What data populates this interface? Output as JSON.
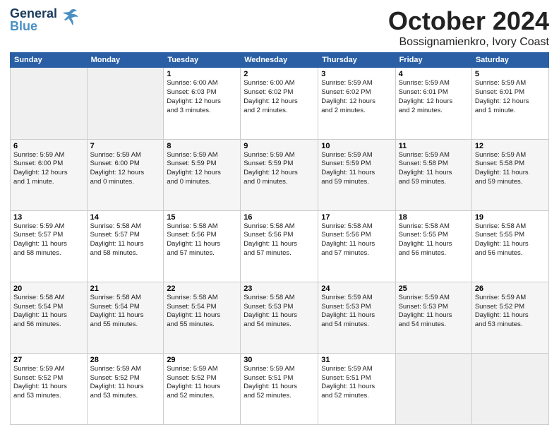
{
  "logo": {
    "line1": "General",
    "line2": "Blue"
  },
  "header": {
    "month": "October 2024",
    "location": "Bossignamienkro, Ivory Coast"
  },
  "weekdays": [
    "Sunday",
    "Monday",
    "Tuesday",
    "Wednesday",
    "Thursday",
    "Friday",
    "Saturday"
  ],
  "weeks": [
    [
      {
        "day": "",
        "info": ""
      },
      {
        "day": "",
        "info": ""
      },
      {
        "day": "1",
        "info": "Sunrise: 6:00 AM\nSunset: 6:03 PM\nDaylight: 12 hours\nand 3 minutes."
      },
      {
        "day": "2",
        "info": "Sunrise: 6:00 AM\nSunset: 6:02 PM\nDaylight: 12 hours\nand 2 minutes."
      },
      {
        "day": "3",
        "info": "Sunrise: 5:59 AM\nSunset: 6:02 PM\nDaylight: 12 hours\nand 2 minutes."
      },
      {
        "day": "4",
        "info": "Sunrise: 5:59 AM\nSunset: 6:01 PM\nDaylight: 12 hours\nand 2 minutes."
      },
      {
        "day": "5",
        "info": "Sunrise: 5:59 AM\nSunset: 6:01 PM\nDaylight: 12 hours\nand 1 minute."
      }
    ],
    [
      {
        "day": "6",
        "info": "Sunrise: 5:59 AM\nSunset: 6:00 PM\nDaylight: 12 hours\nand 1 minute."
      },
      {
        "day": "7",
        "info": "Sunrise: 5:59 AM\nSunset: 6:00 PM\nDaylight: 12 hours\nand 0 minutes."
      },
      {
        "day": "8",
        "info": "Sunrise: 5:59 AM\nSunset: 5:59 PM\nDaylight: 12 hours\nand 0 minutes."
      },
      {
        "day": "9",
        "info": "Sunrise: 5:59 AM\nSunset: 5:59 PM\nDaylight: 12 hours\nand 0 minutes."
      },
      {
        "day": "10",
        "info": "Sunrise: 5:59 AM\nSunset: 5:59 PM\nDaylight: 11 hours\nand 59 minutes."
      },
      {
        "day": "11",
        "info": "Sunrise: 5:59 AM\nSunset: 5:58 PM\nDaylight: 11 hours\nand 59 minutes."
      },
      {
        "day": "12",
        "info": "Sunrise: 5:59 AM\nSunset: 5:58 PM\nDaylight: 11 hours\nand 59 minutes."
      }
    ],
    [
      {
        "day": "13",
        "info": "Sunrise: 5:59 AM\nSunset: 5:57 PM\nDaylight: 11 hours\nand 58 minutes."
      },
      {
        "day": "14",
        "info": "Sunrise: 5:58 AM\nSunset: 5:57 PM\nDaylight: 11 hours\nand 58 minutes."
      },
      {
        "day": "15",
        "info": "Sunrise: 5:58 AM\nSunset: 5:56 PM\nDaylight: 11 hours\nand 57 minutes."
      },
      {
        "day": "16",
        "info": "Sunrise: 5:58 AM\nSunset: 5:56 PM\nDaylight: 11 hours\nand 57 minutes."
      },
      {
        "day": "17",
        "info": "Sunrise: 5:58 AM\nSunset: 5:56 PM\nDaylight: 11 hours\nand 57 minutes."
      },
      {
        "day": "18",
        "info": "Sunrise: 5:58 AM\nSunset: 5:55 PM\nDaylight: 11 hours\nand 56 minutes."
      },
      {
        "day": "19",
        "info": "Sunrise: 5:58 AM\nSunset: 5:55 PM\nDaylight: 11 hours\nand 56 minutes."
      }
    ],
    [
      {
        "day": "20",
        "info": "Sunrise: 5:58 AM\nSunset: 5:54 PM\nDaylight: 11 hours\nand 56 minutes."
      },
      {
        "day": "21",
        "info": "Sunrise: 5:58 AM\nSunset: 5:54 PM\nDaylight: 11 hours\nand 55 minutes."
      },
      {
        "day": "22",
        "info": "Sunrise: 5:58 AM\nSunset: 5:54 PM\nDaylight: 11 hours\nand 55 minutes."
      },
      {
        "day": "23",
        "info": "Sunrise: 5:58 AM\nSunset: 5:53 PM\nDaylight: 11 hours\nand 54 minutes."
      },
      {
        "day": "24",
        "info": "Sunrise: 5:59 AM\nSunset: 5:53 PM\nDaylight: 11 hours\nand 54 minutes."
      },
      {
        "day": "25",
        "info": "Sunrise: 5:59 AM\nSunset: 5:53 PM\nDaylight: 11 hours\nand 54 minutes."
      },
      {
        "day": "26",
        "info": "Sunrise: 5:59 AM\nSunset: 5:52 PM\nDaylight: 11 hours\nand 53 minutes."
      }
    ],
    [
      {
        "day": "27",
        "info": "Sunrise: 5:59 AM\nSunset: 5:52 PM\nDaylight: 11 hours\nand 53 minutes."
      },
      {
        "day": "28",
        "info": "Sunrise: 5:59 AM\nSunset: 5:52 PM\nDaylight: 11 hours\nand 53 minutes."
      },
      {
        "day": "29",
        "info": "Sunrise: 5:59 AM\nSunset: 5:52 PM\nDaylight: 11 hours\nand 52 minutes."
      },
      {
        "day": "30",
        "info": "Sunrise: 5:59 AM\nSunset: 5:51 PM\nDaylight: 11 hours\nand 52 minutes."
      },
      {
        "day": "31",
        "info": "Sunrise: 5:59 AM\nSunset: 5:51 PM\nDaylight: 11 hours\nand 52 minutes."
      },
      {
        "day": "",
        "info": ""
      },
      {
        "day": "",
        "info": ""
      }
    ]
  ]
}
